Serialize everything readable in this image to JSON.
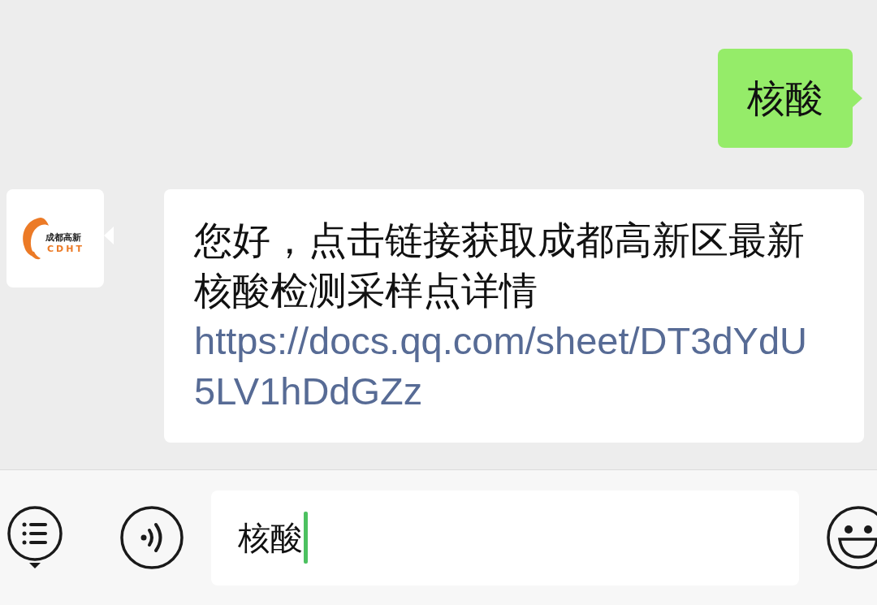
{
  "messages": [
    {
      "kind": "outgoing",
      "text": "核酸"
    },
    {
      "kind": "incoming",
      "avatar": {
        "logo_title": "成都高新",
        "logo_subtitle": "CDHT"
      },
      "text": "您好，点击链接获取成都高新区最新核酸检测采样点详情",
      "link": "https://docs.qq.com/sheet/DT3dYdU5LV1hDdGZz"
    }
  ],
  "input_bar": {
    "value": "核酸"
  }
}
